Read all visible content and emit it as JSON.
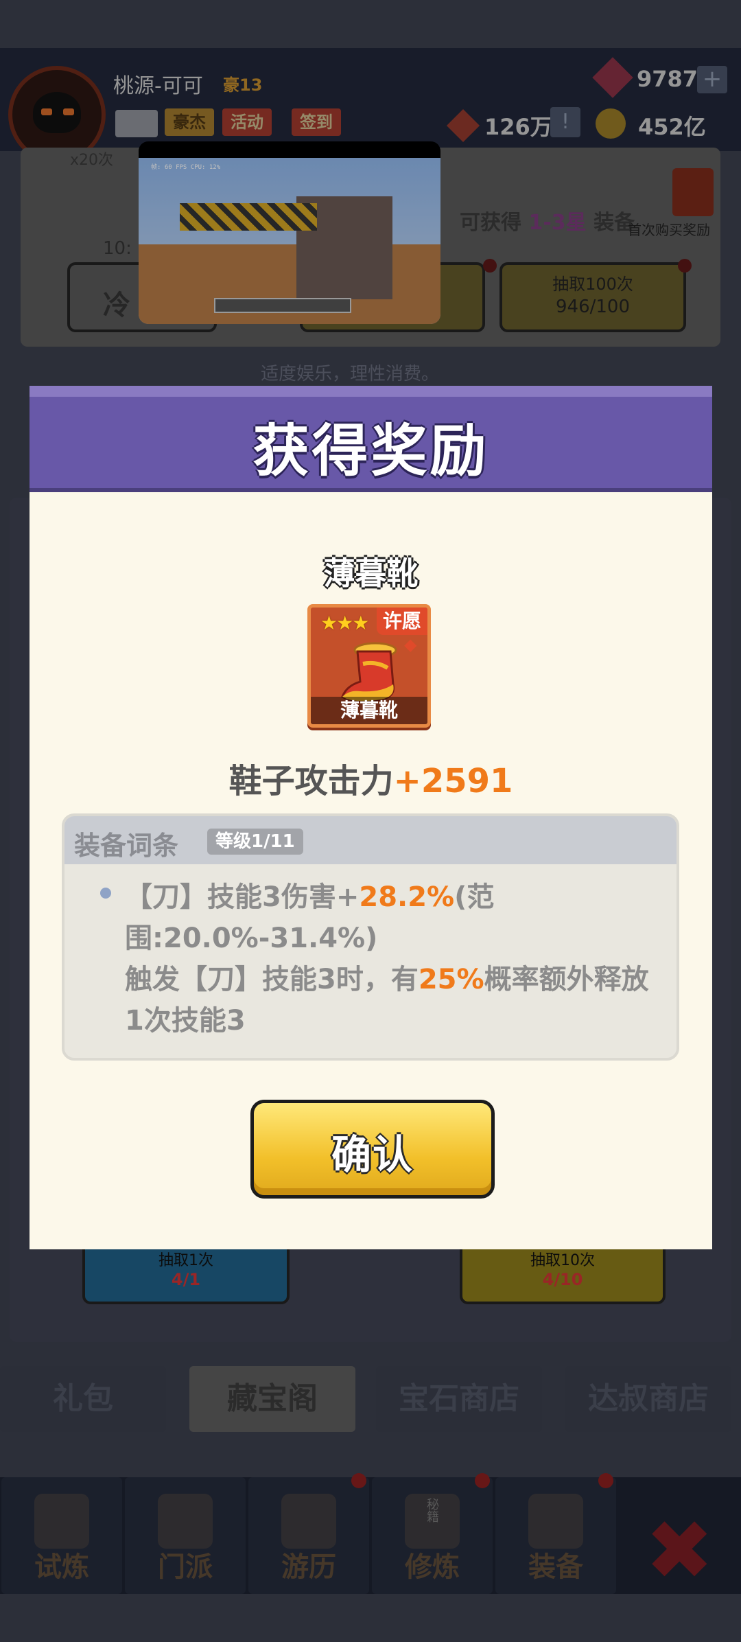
{
  "player": {
    "name": "桃源-可可",
    "vip": "豪13"
  },
  "top_buttons": {
    "hero": "豪杰",
    "activity": "活动",
    "signin": "签到"
  },
  "resources": {
    "gems": "9787",
    "tokens": "126万",
    "coins": "452亿",
    "plus": "+",
    "excl": "!"
  },
  "background_panel": {
    "discount_note": "x20次",
    "obtain_text": "可获得",
    "obtain_range": "1-3星",
    "obtain_suffix": "装备",
    "first_buy": "首次购买奖励",
    "timer_prefix": "10:",
    "cooldown": "冷",
    "draw100_label": "抽取100次",
    "draw100_count": "946/100",
    "tagline": "适度娱乐，理性消费。",
    "draw1_label": "抽取1次",
    "draw1_count": "4/1",
    "draw10_label": "抽取10次",
    "draw10_count": "4/10"
  },
  "shop_tabs": [
    "礼包",
    "藏宝阁",
    "宝石商店",
    "达叔商店"
  ],
  "nav": [
    "试炼",
    "门派",
    "游历",
    "修炼",
    "装备"
  ],
  "nav_extra": {
    "scroll_text": "秘籍"
  },
  "video": {
    "hud_text": "帧: 60 FPS\nCPU: 12%"
  },
  "modal": {
    "title": "获得奖励",
    "item_name": "薄暮靴",
    "item_badge": "许愿",
    "item_card_label": "薄暮靴",
    "item_stars": 3,
    "stat_label": "鞋子攻击力",
    "stat_value": "+2591",
    "affix_title": "装备词条",
    "affix_level": "等级1/11",
    "affix": {
      "p1": "【刀】技能3伤害+",
      "v1": "28.2%",
      "p2": "(范围:20.0%-31.4%)",
      "p3": "触发【刀】技能3时，有",
      "v2": "25%",
      "p4": "概率额外释放1次技能3"
    },
    "confirm": "确认"
  },
  "colors": {
    "header_purple": "#6858a8",
    "modal_bg": "#fcf8ea",
    "highlight_orange": "#f07a1a",
    "confirm_yellow": "#f2c02a"
  }
}
